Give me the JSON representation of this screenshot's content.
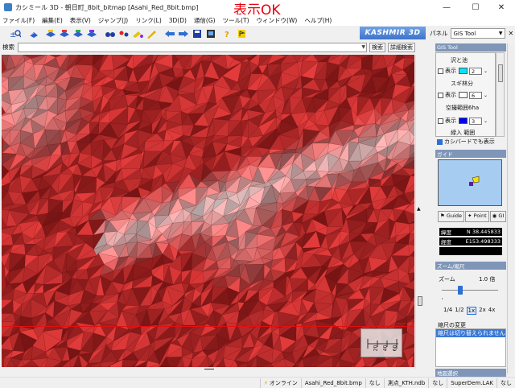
{
  "window": {
    "title": "カシミール 3D - 朝日町_8bit_bitmap [Asahi_Red_8bit.bmp]",
    "overlay_label": "表示OK",
    "minimize": "—",
    "maximize": "☐",
    "close": "✕"
  },
  "menu": [
    "ファイル(F)",
    "編集(E)",
    "表示(V)",
    "ジャンプ(J)",
    "リンク(L)",
    "3D(D)",
    "通信(G)",
    "ツール(T)",
    "ウィンドウ(W)",
    "ヘルプ(H)"
  ],
  "toolbar": {
    "icons": [
      "zoom-search",
      "book",
      "bank-left",
      "bank-mid",
      "bank-right",
      "bank-b",
      "binoculars",
      "pins",
      "pencil-tag",
      "pencil",
      "arrow-left",
      "arrow-right",
      "save",
      "monitor",
      "help",
      "flag"
    ],
    "brand": "KASHMIR 3D"
  },
  "search": {
    "label": "検索",
    "value": "",
    "search_button": "検索",
    "advanced_button": "詳細検索"
  },
  "right_panel": {
    "panel_label": "パネル",
    "panel_select": "GIS Tool",
    "gis_header": "GIS Tool",
    "gis_items": [
      {
        "title": "沢と池",
        "show": "表示",
        "color": "#00e5ff",
        "value": "2"
      },
      {
        "title": "スギ林分",
        "show": "表示",
        "color": "#ffffff",
        "value": "6"
      },
      {
        "title": "空撮範囲6ha",
        "show": "表示",
        "color": "#0000ee",
        "value": "3"
      },
      {
        "title": "緑入 範囲",
        "show": "",
        "color": "",
        "value": ""
      }
    ],
    "canpad_label": "カシバードでも表示",
    "guide_header": "ガイド",
    "guide_tabs": [
      "Guide",
      "Point",
      "GI"
    ],
    "lat_label": "緯度",
    "lat_value": "N 38.445833",
    "lon_label": "経度",
    "lon_value": "E153.498333",
    "zoom_header": "ズーム/縮尺",
    "zoom_label": "ズーム",
    "zoom_value": "1.0 倍",
    "zoom_buttons": [
      "1/4",
      "1/2",
      "1x",
      "2x",
      "4x"
    ],
    "change_header": "縮尺の変更",
    "change_text": "縮尺は切り替えられません",
    "bottom_header": "地図選択"
  },
  "ruler": {
    "ticks": [
      "20",
      "40",
      "60"
    ]
  },
  "status": {
    "online": "オンライン",
    "file": "Asahi_Red_8bit.bmp",
    "none1": "なし",
    "survey": "測点_KTH.ndb",
    "none2": "なし",
    "dem": "SuperDem.LAK",
    "none3": "なし"
  }
}
